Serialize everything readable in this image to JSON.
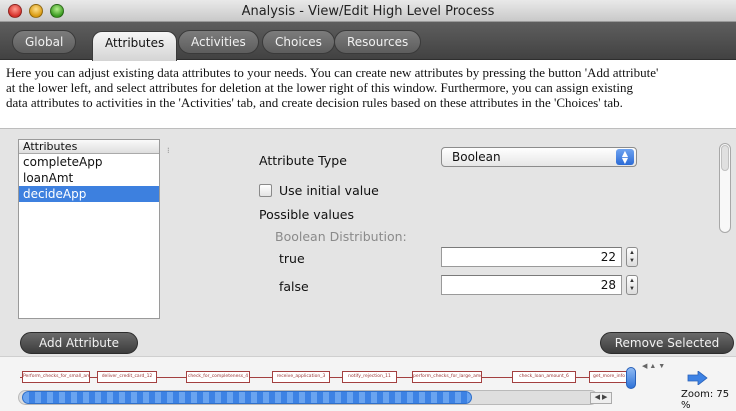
{
  "window": {
    "title": "Analysis - View/Edit High Level Process"
  },
  "tabs": [
    {
      "label": "Global",
      "active": false
    },
    {
      "label": "Attributes",
      "active": true
    },
    {
      "label": "Activities",
      "active": false
    },
    {
      "label": "Choices",
      "active": false
    },
    {
      "label": "Resources",
      "active": false
    }
  ],
  "description": {
    "line1": "Here you can adjust existing data attributes to your needs. You can create new attributes by pressing the button 'Add attribute'",
    "line2": "at the lower left, and select attributes for deletion at the lower right of this window.  Furthermore, you can assign existing",
    "line3": "data attributes to activities in the 'Activities' tab, and create decision rules based on these attributes in the 'Choices' tab."
  },
  "attribute_list": {
    "header": "Attributes",
    "items": [
      "completeApp",
      "loanAmt",
      "decideApp"
    ],
    "selected": "decideApp"
  },
  "form": {
    "attribute_type_label": "Attribute Type",
    "attribute_type_value": "Boolean",
    "use_initial_value_label": "Use initial value",
    "use_initial_value_checked": false,
    "possible_values_label": "Possible values",
    "distribution_label": "Boolean Distribution:",
    "true_label": "true",
    "true_value": "22",
    "false_label": "false",
    "false_value": "28"
  },
  "buttons": {
    "add_attribute": "Add Attribute",
    "remove_selected": "Remove Selected"
  },
  "process_strip": {
    "boxes": [
      "Perform_checks_for_small_amount_6",
      "deliver_credit_card_12",
      "check_for_completeness_4",
      "receive_application_3",
      "notify_rejection_11",
      "perform_checks_for_large_amount_7",
      "check_loan_amount_6",
      "get_more_info"
    ],
    "zoom_label": "Zoom: 75 %"
  },
  "colors": {
    "selection": "#3d80df",
    "tab_bar": "#4e4e4e",
    "process_box": "#a34040"
  }
}
